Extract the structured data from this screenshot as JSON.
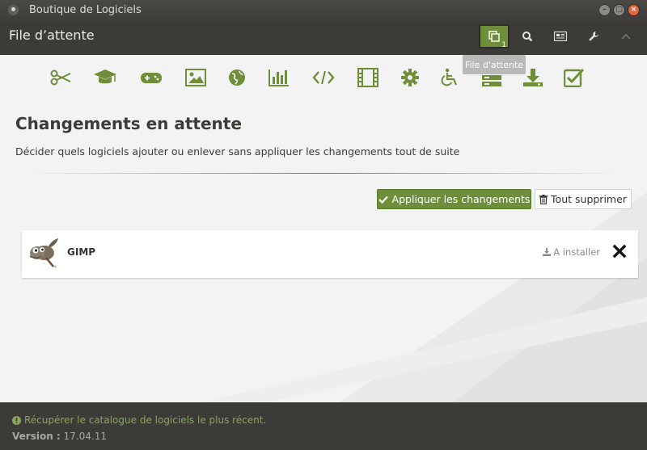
{
  "window": {
    "title": "Boutique de Logiciels",
    "controls": [
      "minimize",
      "maximize",
      "close"
    ]
  },
  "header": {
    "title": "File d’attente",
    "buttons": [
      {
        "name": "queue-icon",
        "badge": "1",
        "active": true
      },
      {
        "name": "search-icon"
      },
      {
        "name": "news-icon"
      },
      {
        "name": "wrench-icon"
      },
      {
        "name": "chevron-up-icon"
      }
    ],
    "tooltip": "File d'attente"
  },
  "categories": [
    "scissors-icon",
    "graduation-cap-icon",
    "gamepad-icon",
    "image-icon",
    "globe-icon",
    "bar-chart-icon",
    "code-icon",
    "film-icon",
    "gear-icon",
    "wheelchair-icon",
    "server-icon",
    "download-icon",
    "checkbox-icon"
  ],
  "main": {
    "title": "Changements en attente",
    "description": "Décider quels logiciels ajouter ou enlever sans appliquer les changements tout de suite",
    "apply_label": "Appliquer les changements",
    "delete_label": "Tout supprimer"
  },
  "queue": [
    {
      "name": "GIMP",
      "status": "A installer",
      "icon": "gimp-icon"
    }
  ],
  "footer": {
    "refresh_text": "Récupérer le catalogue de logiciels le plus récent.",
    "version_label": "Version :",
    "version_value": "17.04.11"
  },
  "colors": {
    "accent": "#6e8e3a",
    "bar": "#3c3b37",
    "content_bg": "#f3f3f3"
  }
}
